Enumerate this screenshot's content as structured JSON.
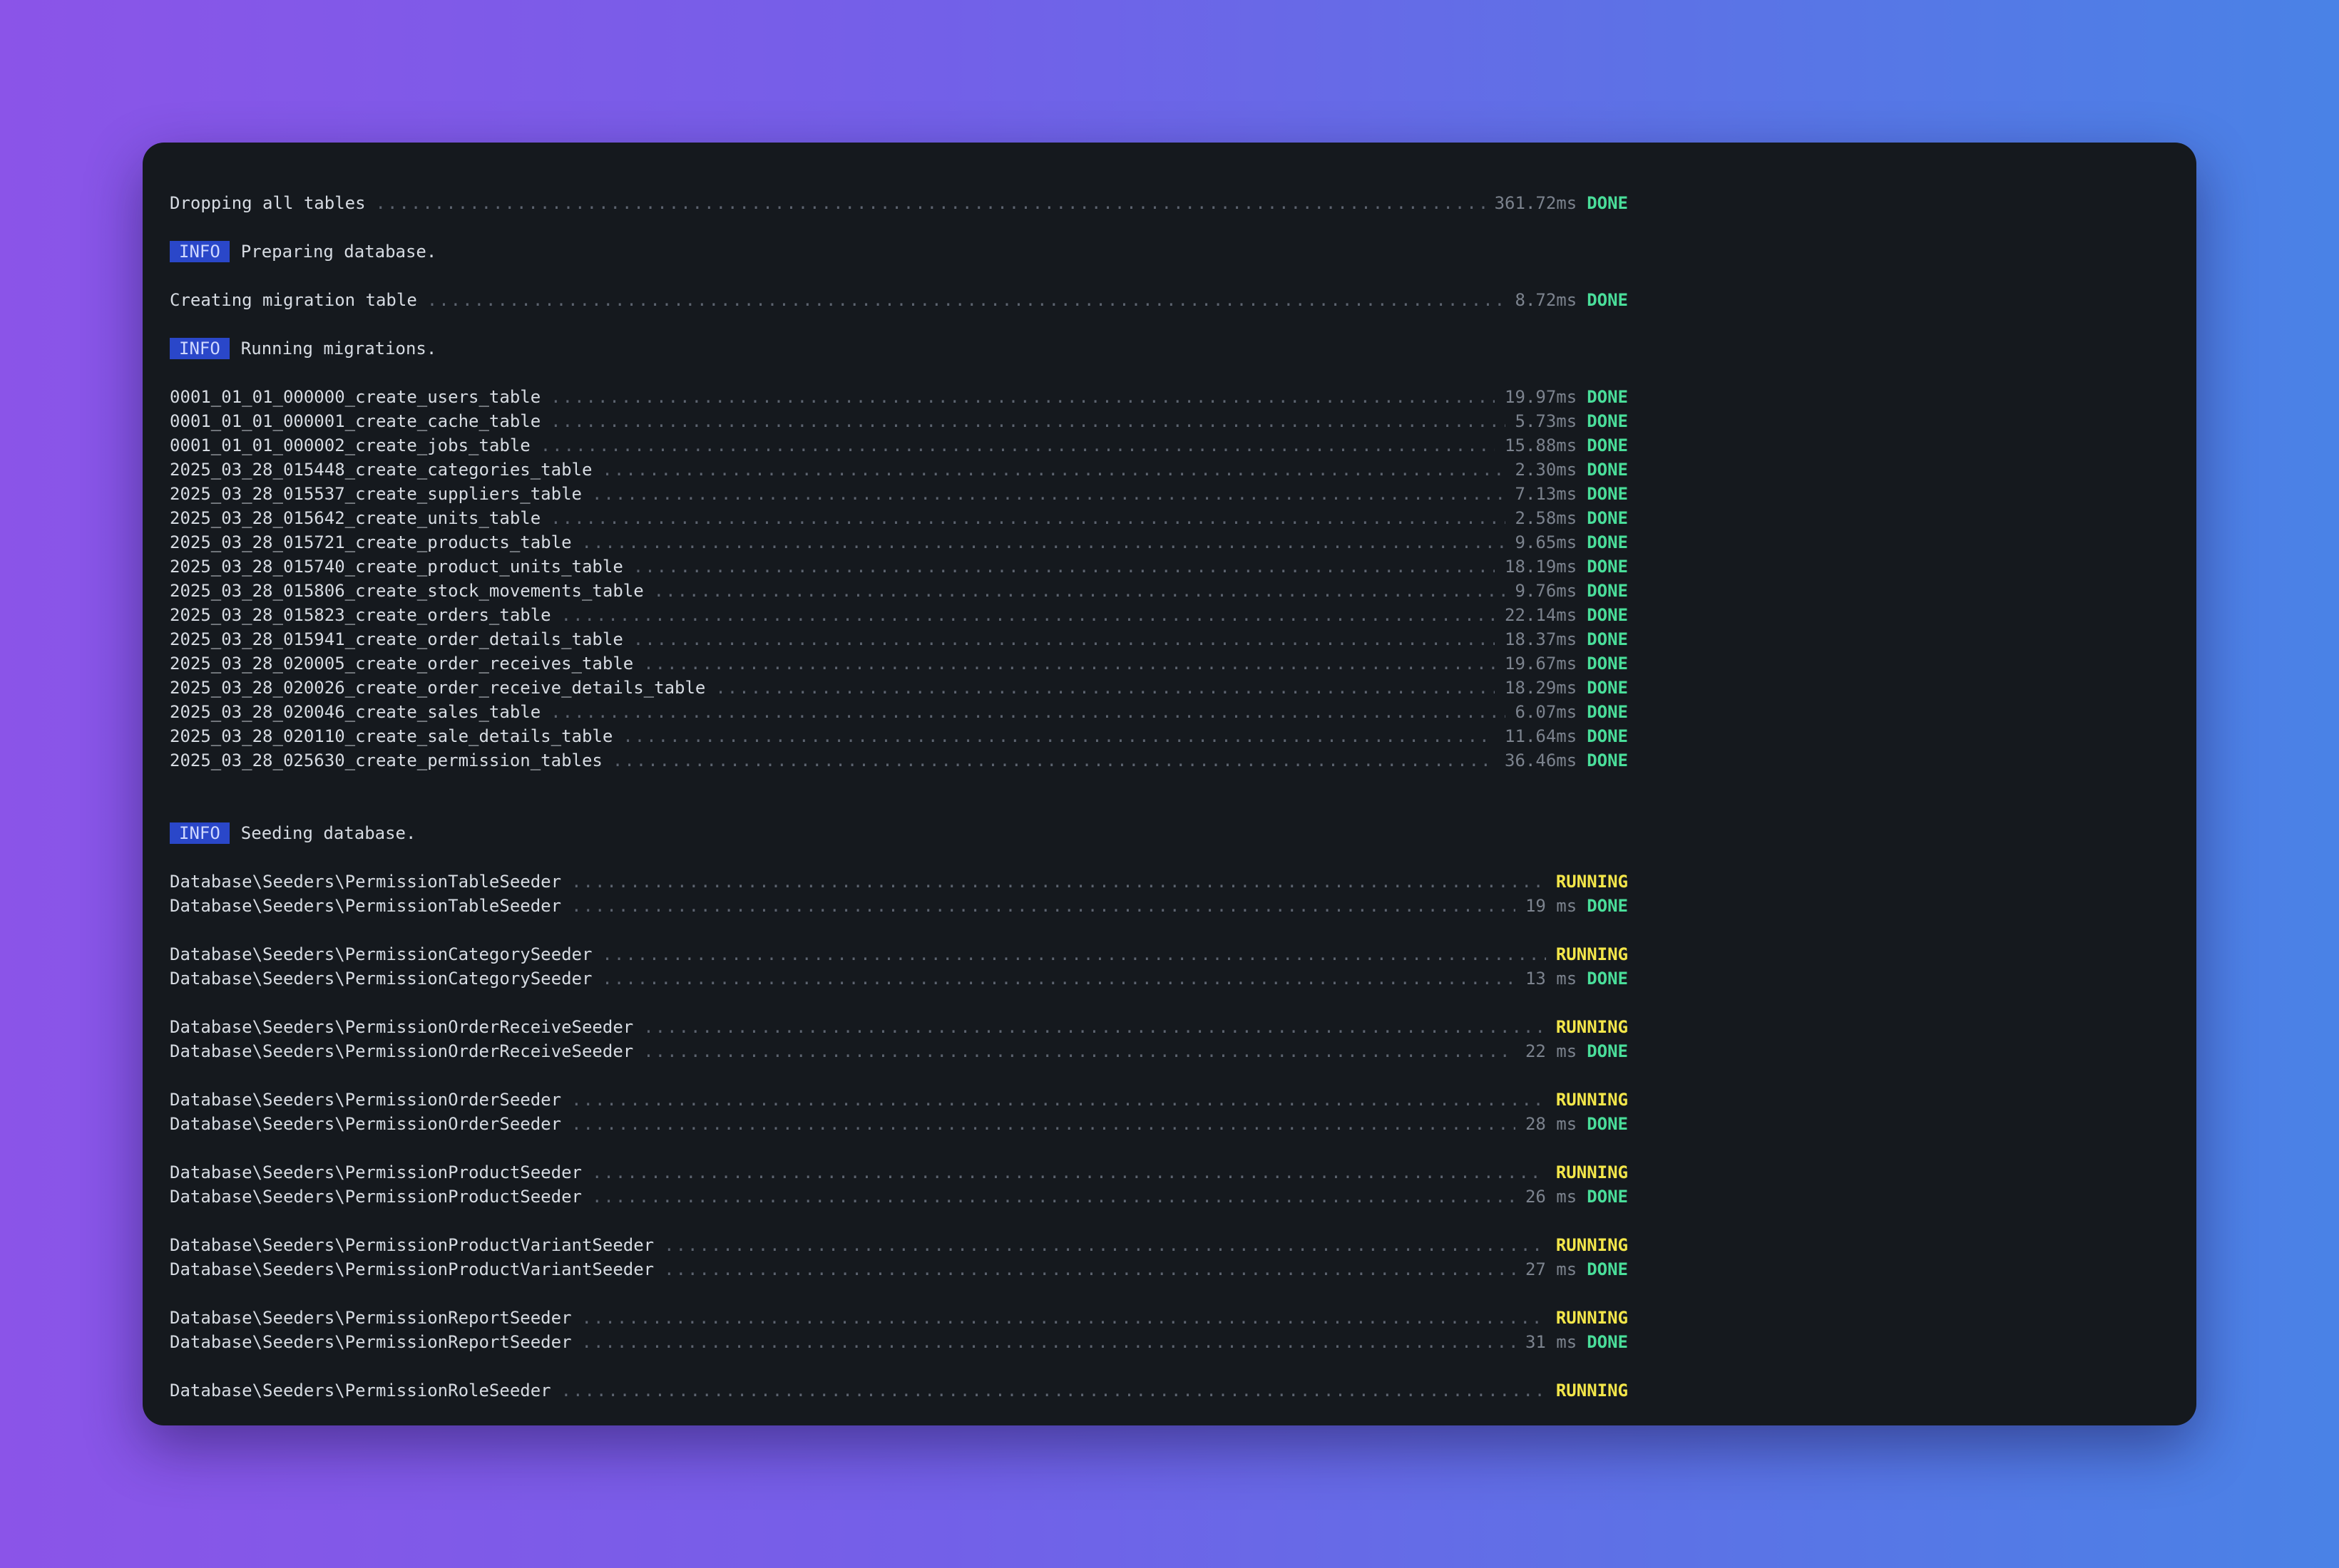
{
  "colors": {
    "terminal_bg": "#15191e",
    "done": "#4ade9a",
    "running": "#f3e64a",
    "info_badge": "#2a47c9",
    "text": "#d6dbe2",
    "muted": "#7c838e"
  },
  "badge_label": "INFO",
  "dropping": {
    "name": "Dropping all tables",
    "time": "361.72ms",
    "status": "DONE"
  },
  "info_preparing": "Preparing database.",
  "creating": {
    "name": "Creating migration table",
    "time": "8.72ms",
    "status": "DONE"
  },
  "info_migrations": "Running migrations.",
  "migrations": [
    {
      "name": "0001_01_01_000000_create_users_table",
      "time": "19.97ms",
      "status": "DONE"
    },
    {
      "name": "0001_01_01_000001_create_cache_table",
      "time": "5.73ms",
      "status": "DONE"
    },
    {
      "name": "0001_01_01_000002_create_jobs_table",
      "time": "15.88ms",
      "status": "DONE"
    },
    {
      "name": "2025_03_28_015448_create_categories_table",
      "time": "2.30ms",
      "status": "DONE"
    },
    {
      "name": "2025_03_28_015537_create_suppliers_table",
      "time": "7.13ms",
      "status": "DONE"
    },
    {
      "name": "2025_03_28_015642_create_units_table",
      "time": "2.58ms",
      "status": "DONE"
    },
    {
      "name": "2025_03_28_015721_create_products_table",
      "time": "9.65ms",
      "status": "DONE"
    },
    {
      "name": "2025_03_28_015740_create_product_units_table",
      "time": "18.19ms",
      "status": "DONE"
    },
    {
      "name": "2025_03_28_015806_create_stock_movements_table",
      "time": "9.76ms",
      "status": "DONE"
    },
    {
      "name": "2025_03_28_015823_create_orders_table",
      "time": "22.14ms",
      "status": "DONE"
    },
    {
      "name": "2025_03_28_015941_create_order_details_table",
      "time": "18.37ms",
      "status": "DONE"
    },
    {
      "name": "2025_03_28_020005_create_order_receives_table",
      "time": "19.67ms",
      "status": "DONE"
    },
    {
      "name": "2025_03_28_020026_create_order_receive_details_table",
      "time": "18.29ms",
      "status": "DONE"
    },
    {
      "name": "2025_03_28_020046_create_sales_table",
      "time": "6.07ms",
      "status": "DONE"
    },
    {
      "name": "2025_03_28_020110_create_sale_details_table",
      "time": "11.64ms",
      "status": "DONE"
    },
    {
      "name": "2025_03_28_025630_create_permission_tables",
      "time": "36.46ms",
      "status": "DONE"
    }
  ],
  "info_seeding": "Seeding database.",
  "seeders": [
    {
      "name": "Database\\Seeders\\PermissionTableSeeder",
      "running": "RUNNING",
      "time": "19 ms",
      "done": "DONE"
    },
    {
      "name": "Database\\Seeders\\PermissionCategorySeeder",
      "running": "RUNNING",
      "time": "13 ms",
      "done": "DONE"
    },
    {
      "name": "Database\\Seeders\\PermissionOrderReceiveSeeder",
      "running": "RUNNING",
      "time": "22 ms",
      "done": "DONE"
    },
    {
      "name": "Database\\Seeders\\PermissionOrderSeeder",
      "running": "RUNNING",
      "time": "28 ms",
      "done": "DONE"
    },
    {
      "name": "Database\\Seeders\\PermissionProductSeeder",
      "running": "RUNNING",
      "time": "26 ms",
      "done": "DONE"
    },
    {
      "name": "Database\\Seeders\\PermissionProductVariantSeeder",
      "running": "RUNNING",
      "time": "27 ms",
      "done": "DONE"
    },
    {
      "name": "Database\\Seeders\\PermissionReportSeeder",
      "running": "RUNNING",
      "time": "31 ms",
      "done": "DONE"
    },
    {
      "name": "Database\\Seeders\\PermissionRoleSeeder",
      "running": "RUNNING"
    }
  ]
}
